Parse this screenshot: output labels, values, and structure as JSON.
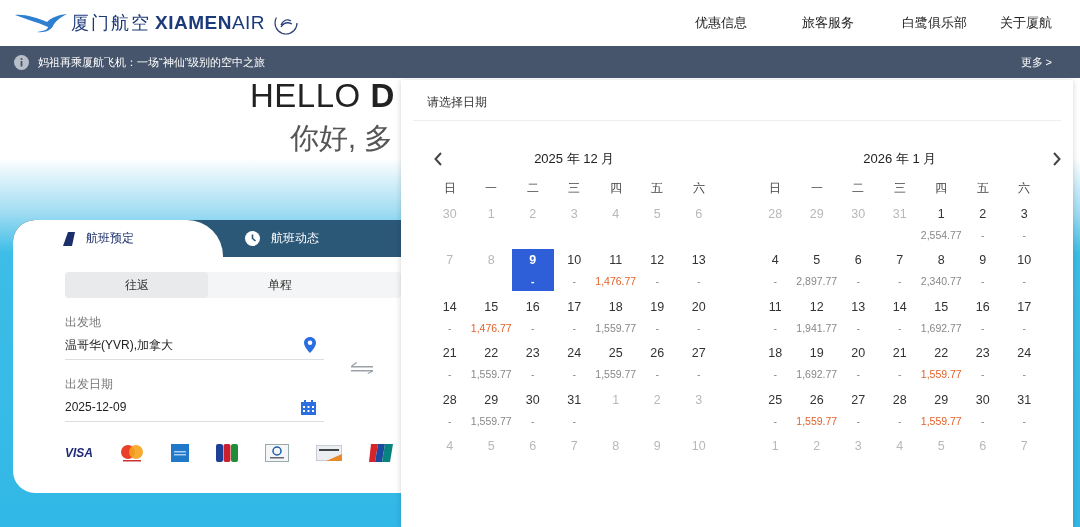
{
  "header": {
    "logo": {
      "chinese": "厦门航空",
      "english_bold": "XIAMEN",
      "english_light": "AIR"
    },
    "nav": [
      {
        "label": "优惠信息"
      },
      {
        "label": "旅客服务"
      },
      {
        "label": "白鹭俱乐部"
      },
      {
        "label": "关于厦航"
      }
    ]
  },
  "notice": {
    "text": "妈祖再乘厦航飞机：一场“神仙”级别的空中之旅",
    "more": "更多 >"
  },
  "hero": {
    "line1": "HELLO **D**",
    "line2": "你好, 多"
  },
  "booking": {
    "tabs": [
      {
        "label": "航班预定",
        "kind": "plane",
        "selected": true
      },
      {
        "label": "航班动态",
        "kind": "clock",
        "selected": false
      }
    ],
    "trip_types": [
      {
        "label": "往返",
        "selected": true
      },
      {
        "label": "单程",
        "selected": false
      }
    ],
    "fields": [
      {
        "label": "出发地",
        "value": "温哥华(YVR),加拿大",
        "kind": "location"
      },
      {
        "label": "出发日期",
        "value": "2025-12-09",
        "kind": "calendar"
      }
    ],
    "payment_logos": [
      {
        "kind": "visa",
        "label": "VISA"
      },
      {
        "kind": "mastercard"
      },
      {
        "kind": "amex"
      },
      {
        "kind": "jcb"
      },
      {
        "kind": "diners"
      },
      {
        "kind": "discover"
      },
      {
        "kind": "unionpay"
      }
    ]
  },
  "calendar": {
    "title": "请选择日期",
    "months": [
      {
        "title": "2025 年 12 月",
        "weekdays": [
          "日",
          "一",
          "二",
          "三",
          "四",
          "五",
          "六"
        ],
        "weeks": [
          [
            {
              "day": "30",
              "disabled": true,
              "selected": false
            },
            {
              "day": "1",
              "disabled": true,
              "selected": false
            },
            {
              "day": "2",
              "disabled": true,
              "selected": false
            },
            {
              "day": "3",
              "disabled": true,
              "selected": false
            },
            {
              "day": "4",
              "disabled": true,
              "selected": false
            },
            {
              "day": "5",
              "disabled": true,
              "selected": false
            },
            {
              "day": "6",
              "disabled": true,
              "selected": false
            }
          ],
          [
            {
              "day": "7",
              "disabled": true,
              "selected": false
            },
            {
              "day": "8",
              "disabled": true,
              "selected": false
            },
            {
              "day": "9",
              "disabled": false,
              "selected": true,
              "price": "-",
              "cheap": false
            },
            {
              "day": "10",
              "disabled": false,
              "selected": false,
              "price": "-",
              "cheap": false
            },
            {
              "day": "11",
              "disabled": false,
              "selected": false,
              "price": "1,476.77",
              "cheap": true
            },
            {
              "day": "12",
              "disabled": false,
              "selected": false,
              "price": "-",
              "cheap": false
            },
            {
              "day": "13",
              "disabled": false,
              "selected": false,
              "price": "-",
              "cheap": false
            }
          ],
          [
            {
              "day": "14",
              "disabled": false,
              "selected": false,
              "price": "-",
              "cheap": false
            },
            {
              "day": "15",
              "disabled": false,
              "selected": false,
              "price": "1,476.77",
              "cheap": true
            },
            {
              "day": "16",
              "disabled": false,
              "selected": false,
              "price": "-",
              "cheap": false
            },
            {
              "day": "17",
              "disabled": false,
              "selected": false,
              "price": "-",
              "cheap": false
            },
            {
              "day": "18",
              "disabled": false,
              "selected": false,
              "price": "1,559.77",
              "cheap": false
            },
            {
              "day": "19",
              "disabled": false,
              "selected": false,
              "price": "-",
              "cheap": false
            },
            {
              "day": "20",
              "disabled": false,
              "selected": false,
              "price": "-",
              "cheap": false
            }
          ],
          [
            {
              "day": "21",
              "disabled": false,
              "selected": false,
              "price": "-",
              "cheap": false
            },
            {
              "day": "22",
              "disabled": false,
              "selected": false,
              "price": "1,559.77",
              "cheap": false
            },
            {
              "day": "23",
              "disabled": false,
              "selected": false,
              "price": "-",
              "cheap": false
            },
            {
              "day": "24",
              "disabled": false,
              "selected": false,
              "price": "-",
              "cheap": false
            },
            {
              "day": "25",
              "disabled": false,
              "selected": false,
              "price": "1,559.77",
              "cheap": false
            },
            {
              "day": "26",
              "disabled": false,
              "selected": false,
              "price": "-",
              "cheap": false
            },
            {
              "day": "27",
              "disabled": false,
              "selected": false,
              "price": "-",
              "cheap": false
            }
          ],
          [
            {
              "day": "28",
              "disabled": false,
              "selected": false,
              "price": "-",
              "cheap": false
            },
            {
              "day": "29",
              "disabled": false,
              "selected": false,
              "price": "1,559.77",
              "cheap": false
            },
            {
              "day": "30",
              "disabled": false,
              "selected": false,
              "price": "-",
              "cheap": false
            },
            {
              "day": "31",
              "disabled": false,
              "selected": false,
              "price": "-",
              "cheap": false
            },
            {
              "day": "1",
              "disabled": true,
              "selected": false
            },
            {
              "day": "2",
              "disabled": true,
              "selected": false
            },
            {
              "day": "3",
              "disabled": true,
              "selected": false
            }
          ],
          [
            {
              "day": "4",
              "disabled": true,
              "selected": false
            },
            {
              "day": "5",
              "disabled": true,
              "selected": false
            },
            {
              "day": "6",
              "disabled": true,
              "selected": false
            },
            {
              "day": "7",
              "disabled": true,
              "selected": false
            },
            {
              "day": "8",
              "disabled": true,
              "selected": false
            },
            {
              "day": "9",
              "disabled": true,
              "selected": false
            },
            {
              "day": "10",
              "disabled": true,
              "selected": false
            }
          ]
        ]
      },
      {
        "title": "2026 年 1 月",
        "weekdays": [
          "日",
          "一",
          "二",
          "三",
          "四",
          "五",
          "六"
        ],
        "weeks": [
          [
            {
              "day": "28",
              "disabled": true,
              "selected": false
            },
            {
              "day": "29",
              "disabled": true,
              "selected": false
            },
            {
              "day": "30",
              "disabled": true,
              "selected": false
            },
            {
              "day": "31",
              "disabled": true,
              "selected": false
            },
            {
              "day": "1",
              "disabled": false,
              "selected": false,
              "price": "2,554.77",
              "cheap": false
            },
            {
              "day": "2",
              "disabled": false,
              "selected": false,
              "price": "-",
              "cheap": false
            },
            {
              "day": "3",
              "disabled": false,
              "selected": false,
              "price": "-",
              "cheap": false
            }
          ],
          [
            {
              "day": "4",
              "disabled": false,
              "selected": false,
              "price": "-",
              "cheap": false
            },
            {
              "day": "5",
              "disabled": false,
              "selected": false,
              "price": "2,897.77",
              "cheap": false
            },
            {
              "day": "6",
              "disabled": false,
              "selected": false,
              "price": "-",
              "cheap": false
            },
            {
              "day": "7",
              "disabled": false,
              "selected": false,
              "price": "-",
              "cheap": false
            },
            {
              "day": "8",
              "disabled": false,
              "selected": false,
              "price": "2,340.77",
              "cheap": false
            },
            {
              "day": "9",
              "disabled": false,
              "selected": false,
              "price": "-",
              "cheap": false
            },
            {
              "day": "10",
              "disabled": false,
              "selected": false,
              "price": "-",
              "cheap": false
            }
          ],
          [
            {
              "day": "11",
              "disabled": false,
              "selected": false,
              "price": "-",
              "cheap": false
            },
            {
              "day": "12",
              "disabled": false,
              "selected": false,
              "price": "1,941.77",
              "cheap": false
            },
            {
              "day": "13",
              "disabled": false,
              "selected": false,
              "price": "-",
              "cheap": false
            },
            {
              "day": "14",
              "disabled": false,
              "selected": false,
              "price": "-",
              "cheap": false
            },
            {
              "day": "15",
              "disabled": false,
              "selected": false,
              "price": "1,692.77",
              "cheap": false
            },
            {
              "day": "16",
              "disabled": false,
              "selected": false,
              "price": "-",
              "cheap": false
            },
            {
              "day": "17",
              "disabled": false,
              "selected": false,
              "price": "-",
              "cheap": false
            }
          ],
          [
            {
              "day": "18",
              "disabled": false,
              "selected": false,
              "price": "-",
              "cheap": false
            },
            {
              "day": "19",
              "disabled": false,
              "selected": false,
              "price": "1,692.77",
              "cheap": false
            },
            {
              "day": "20",
              "disabled": false,
              "selected": false,
              "price": "-",
              "cheap": false
            },
            {
              "day": "21",
              "disabled": false,
              "selected": false,
              "price": "-",
              "cheap": false
            },
            {
              "day": "22",
              "disabled": false,
              "selected": false,
              "price": "1,559.77",
              "cheap": true
            },
            {
              "day": "23",
              "disabled": false,
              "selected": false,
              "price": "-",
              "cheap": false
            },
            {
              "day": "24",
              "disabled": false,
              "selected": false,
              "price": "-",
              "cheap": false
            }
          ],
          [
            {
              "day": "25",
              "disabled": false,
              "selected": false,
              "price": "-",
              "cheap": false
            },
            {
              "day": "26",
              "disabled": false,
              "selected": false,
              "price": "1,559.77",
              "cheap": true
            },
            {
              "day": "27",
              "disabled": false,
              "selected": false,
              "price": "-",
              "cheap": false
            },
            {
              "day": "28",
              "disabled": false,
              "selected": false,
              "price": "-",
              "cheap": false
            },
            {
              "day": "29",
              "disabled": false,
              "selected": false,
              "price": "1,559.77",
              "cheap": true
            },
            {
              "day": "30",
              "disabled": false,
              "selected": false,
              "price": "-",
              "cheap": false
            },
            {
              "day": "31",
              "disabled": false,
              "selected": false,
              "price": "-",
              "cheap": false
            }
          ],
          [
            {
              "day": "1",
              "disabled": true,
              "selected": false
            },
            {
              "day": "2",
              "disabled": true,
              "selected": false
            },
            {
              "day": "3",
              "disabled": true,
              "selected": false
            },
            {
              "day": "4",
              "disabled": true,
              "selected": false
            },
            {
              "day": "5",
              "disabled": true,
              "selected": false
            },
            {
              "day": "6",
              "disabled": true,
              "selected": false
            },
            {
              "day": "7",
              "disabled": true,
              "selected": false
            }
          ]
        ]
      }
    ]
  }
}
